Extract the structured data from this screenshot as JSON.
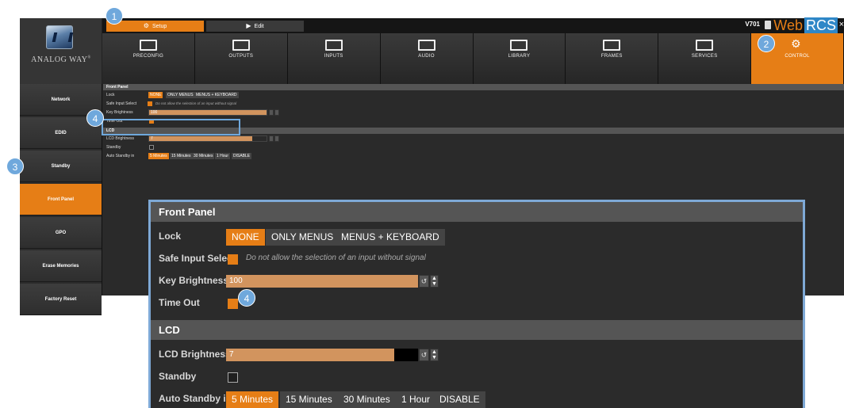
{
  "app": {
    "logo_text": "ANALOG WAY",
    "logo_reg": "®",
    "version": "V701",
    "brand_web": "Web",
    "brand_rcs": "RCS",
    "close": "×"
  },
  "modes": [
    {
      "label": "Setup",
      "icon": "gear-icon",
      "active": true
    },
    {
      "label": "Edit",
      "icon": "play-circle-icon",
      "active": false
    }
  ],
  "nav": [
    {
      "label": "PRECONFIG",
      "icon": "preconfig-icon"
    },
    {
      "label": "OUTPUTS",
      "icon": "outputs-icon"
    },
    {
      "label": "INPUTS",
      "icon": "inputs-icon"
    },
    {
      "label": "AUDIO",
      "icon": "audio-icon"
    },
    {
      "label": "LIBRARY",
      "icon": "library-icon"
    },
    {
      "label": "FRAMES",
      "icon": "frames-icon"
    },
    {
      "label": "SERVICES",
      "icon": "services-icon"
    },
    {
      "label": "CONTROL",
      "icon": "gears-icon",
      "active": true
    }
  ],
  "sidebar": [
    {
      "label": "Network"
    },
    {
      "label": "EDID"
    },
    {
      "label": "Standby"
    },
    {
      "label": "Front Panel",
      "active": true
    },
    {
      "label": "GPO"
    },
    {
      "label": "Erase Memories"
    },
    {
      "label": "Factory Reset"
    }
  ],
  "front_panel": {
    "header": "Front Panel",
    "lock_label": "Lock",
    "lock_options": [
      "NONE",
      "ONLY MENUS",
      "MENUS + KEYBOARD"
    ],
    "lock_selected": "NONE",
    "safe_label": "Safe Input Select",
    "safe_checked": true,
    "safe_note": "Do not allow the selection of an input without signal",
    "key_label": "Key Brightness",
    "key_value": "100",
    "key_fraction": 1.0,
    "timeout_label": "Time Out",
    "timeout_checked": true
  },
  "lcd": {
    "header": "LCD",
    "brightness_label": "LCD Brightness",
    "brightness_value": "7",
    "brightness_fraction": 0.875,
    "standby_label": "Standby",
    "standby_checked": false,
    "auto_label": "Auto Standby in",
    "auto_options": [
      "5 Minutes",
      "15 Minutes",
      "30 Minutes",
      "1 Hour",
      "DISABLE"
    ],
    "auto_selected": "5 Minutes"
  },
  "badges": [
    "1",
    "2",
    "3",
    "4",
    "4"
  ],
  "colors": {
    "accent": "#e67e16",
    "highlight": "#6fa8dc",
    "slider_fill": "#d2945e"
  }
}
